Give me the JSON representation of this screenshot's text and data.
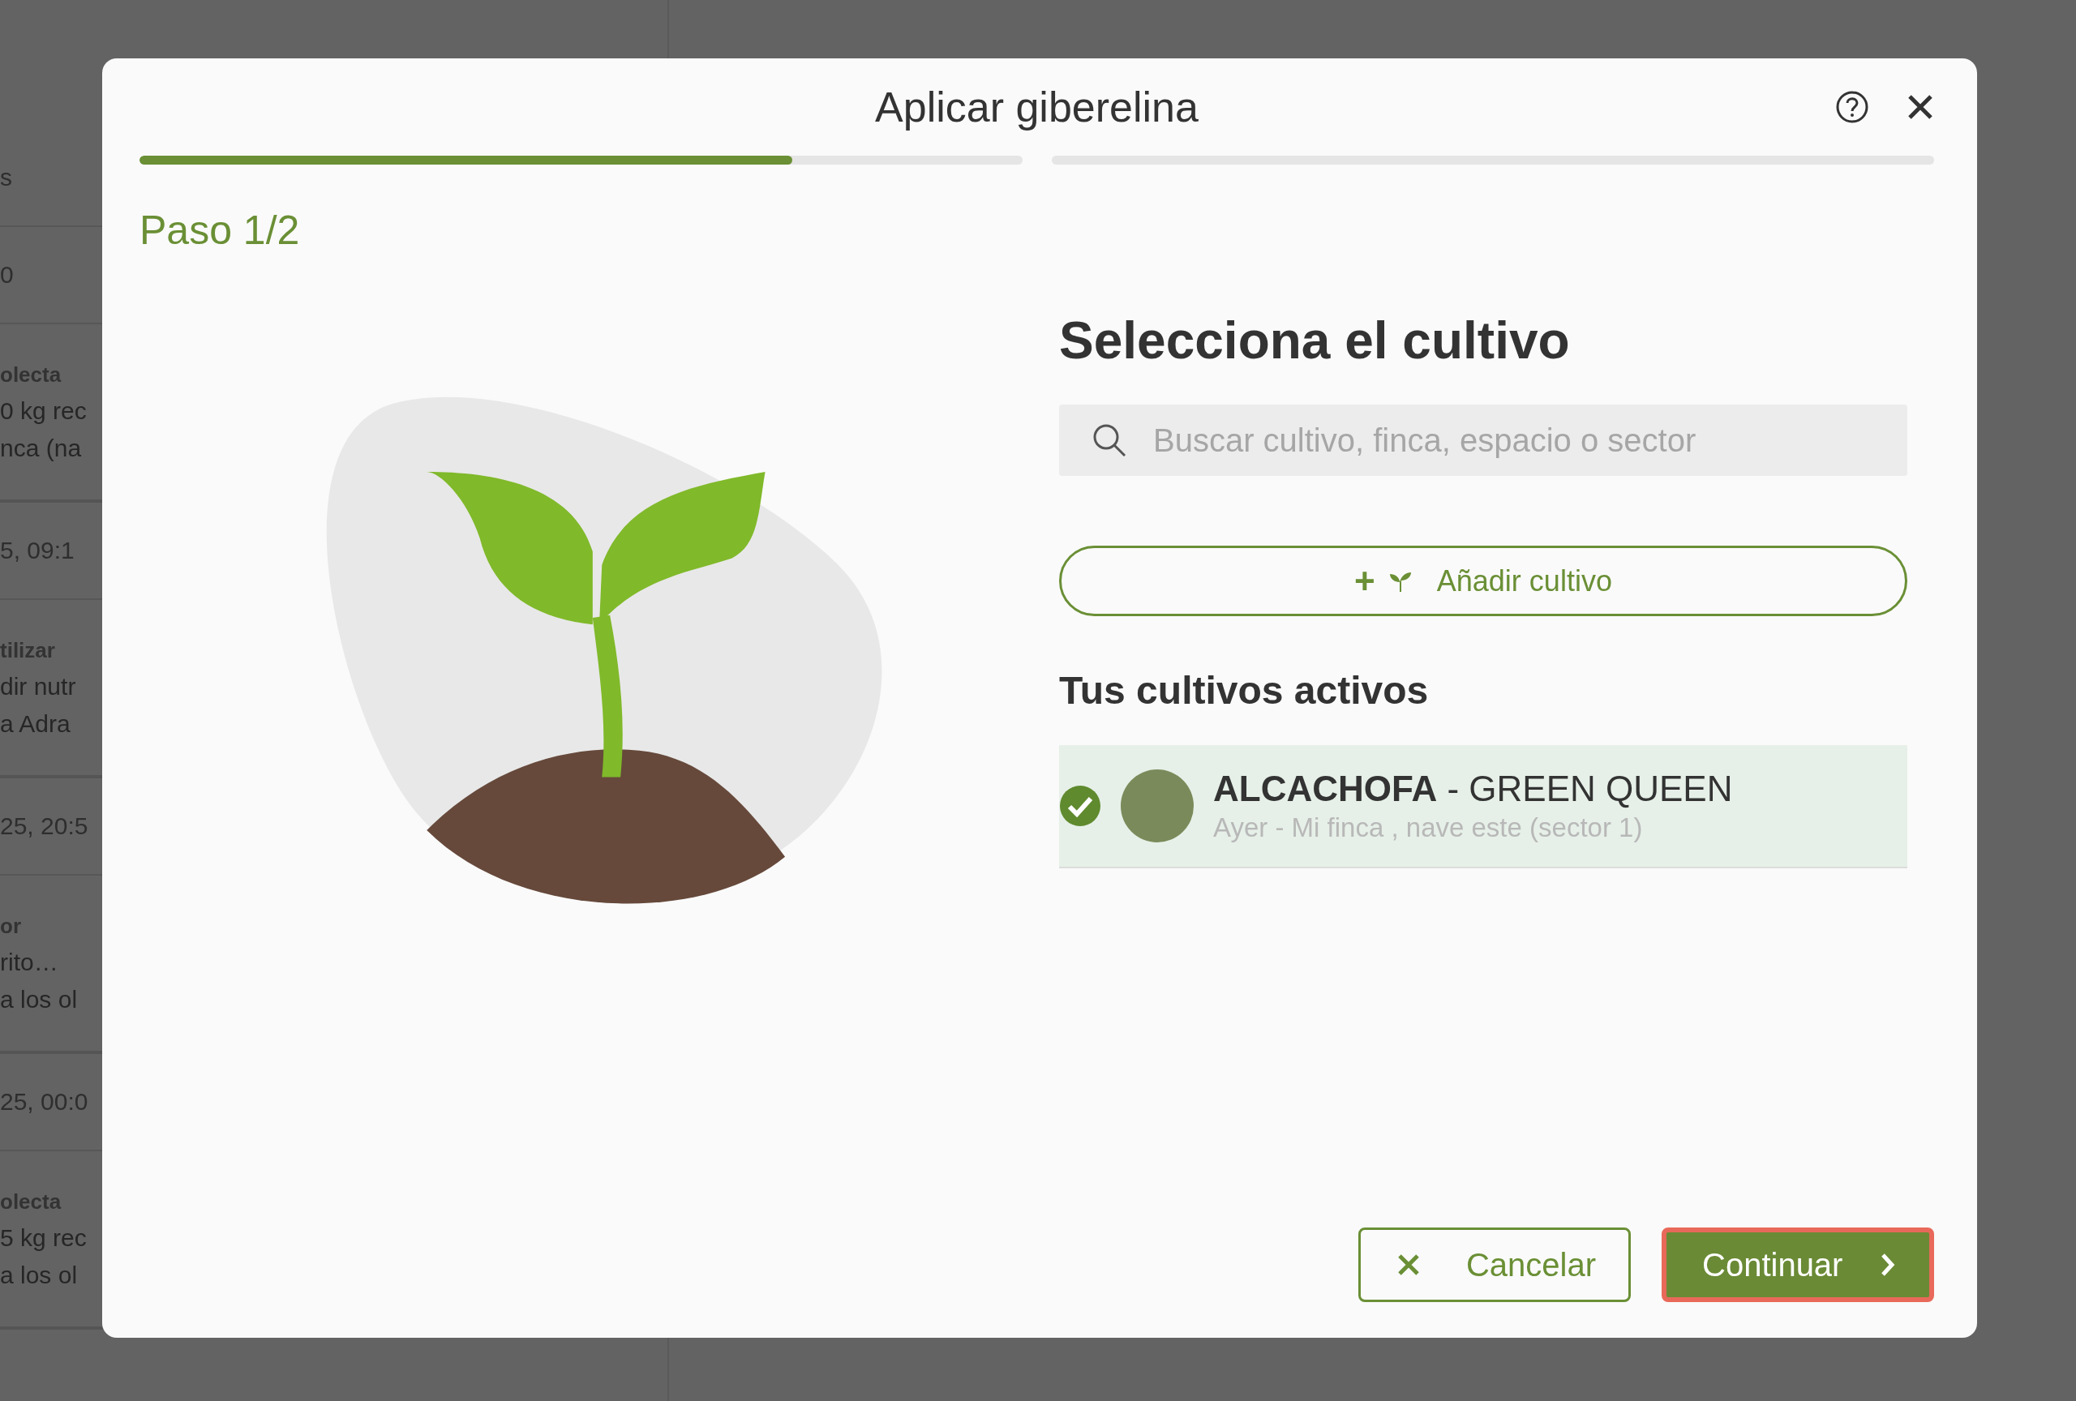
{
  "background": {
    "groups": [
      {
        "lines": [
          {
            "kind": "meta",
            "text": "s"
          }
        ]
      },
      {
        "lines": [
          {
            "kind": "meta",
            "text": "0"
          }
        ]
      },
      {
        "lines": [
          {
            "kind": "title",
            "text": "olecta"
          },
          {
            "kind": "detail",
            "text": "0 kg rec"
          },
          {
            "kind": "detail",
            "text": "nca (na"
          }
        ]
      },
      {
        "lines": [
          {
            "kind": "meta",
            "text": "5, 09:1"
          }
        ]
      },
      {
        "lines": [
          {
            "kind": "title",
            "text": "tilizar"
          },
          {
            "kind": "detail",
            "text": "dir nutr"
          },
          {
            "kind": "detail",
            "text": "a Adra"
          }
        ]
      },
      {
        "lines": [
          {
            "kind": "meta",
            "text": "25, 20:5"
          }
        ]
      },
      {
        "lines": [
          {
            "kind": "title",
            "text": "or"
          },
          {
            "kind": "detail",
            "text": "rito…"
          },
          {
            "kind": "detail",
            "text": "a los ol"
          }
        ]
      },
      {
        "lines": [
          {
            "kind": "meta",
            "text": "25, 00:0"
          }
        ]
      },
      {
        "lines": [
          {
            "kind": "title",
            "text": "olecta"
          },
          {
            "kind": "detail",
            "text": "5 kg rec"
          },
          {
            "kind": "detail",
            "text": "a los ol"
          }
        ]
      }
    ]
  },
  "dialog": {
    "title": "Aplicar giberelina",
    "progress": [
      {
        "current": true,
        "level": 0.74
      },
      {
        "current": false
      }
    ],
    "step": "Paso 1/2",
    "heading": "Selecciona el cultivo",
    "search": {
      "placeholder": "Buscar cultivo, finca, espacio o sector"
    },
    "add_button": {
      "plus": "+",
      "label": "Añadir cultivo"
    },
    "section_title": "Tus cultivos activos",
    "crops": [
      {
        "title": "**ALCACHOFA** - GREEN QUEEN",
        "detail": "Ayer - Mi finca , nave este (sector 1)",
        "selected": true
      }
    ],
    "buttons": [
      {
        "kind": "secondary",
        "label": "Cancelar",
        "focused": false
      },
      {
        "kind": "primary",
        "label": "Continuar",
        "focused": true
      }
    ]
  }
}
